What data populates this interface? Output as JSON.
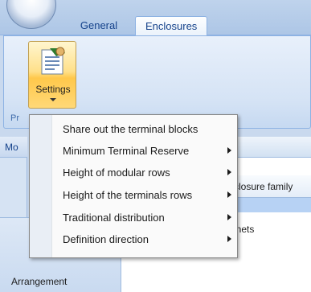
{
  "ribbon": {
    "tabs": [
      {
        "label": "General"
      },
      {
        "label": "Enclosures"
      }
    ],
    "settings_button": {
      "label": "Settings",
      "icon": "settings-document-icon"
    },
    "group_label": "Pr"
  },
  "left_panel": {
    "header_label": "Mo",
    "arrangement": {
      "label": "Arrangement",
      "icon": "arrangement-icon"
    }
  },
  "content": {
    "column_header": "closure family",
    "cell_value": "inets"
  },
  "menu": {
    "items": [
      {
        "label": "Share out the terminal blocks",
        "has_submenu": false
      },
      {
        "label": "Minimum Terminal Reserve",
        "has_submenu": true
      },
      {
        "label": "Height of modular rows",
        "has_submenu": true
      },
      {
        "label": "Height of the terminals rows",
        "has_submenu": true
      },
      {
        "label": "Traditional distribution",
        "has_submenu": true
      },
      {
        "label": "Definition direction",
        "has_submenu": true
      }
    ]
  },
  "colors": {
    "ribbon_text": "#15428b",
    "settings_highlight": "#ffd877",
    "selection": "#b7d2f4"
  }
}
